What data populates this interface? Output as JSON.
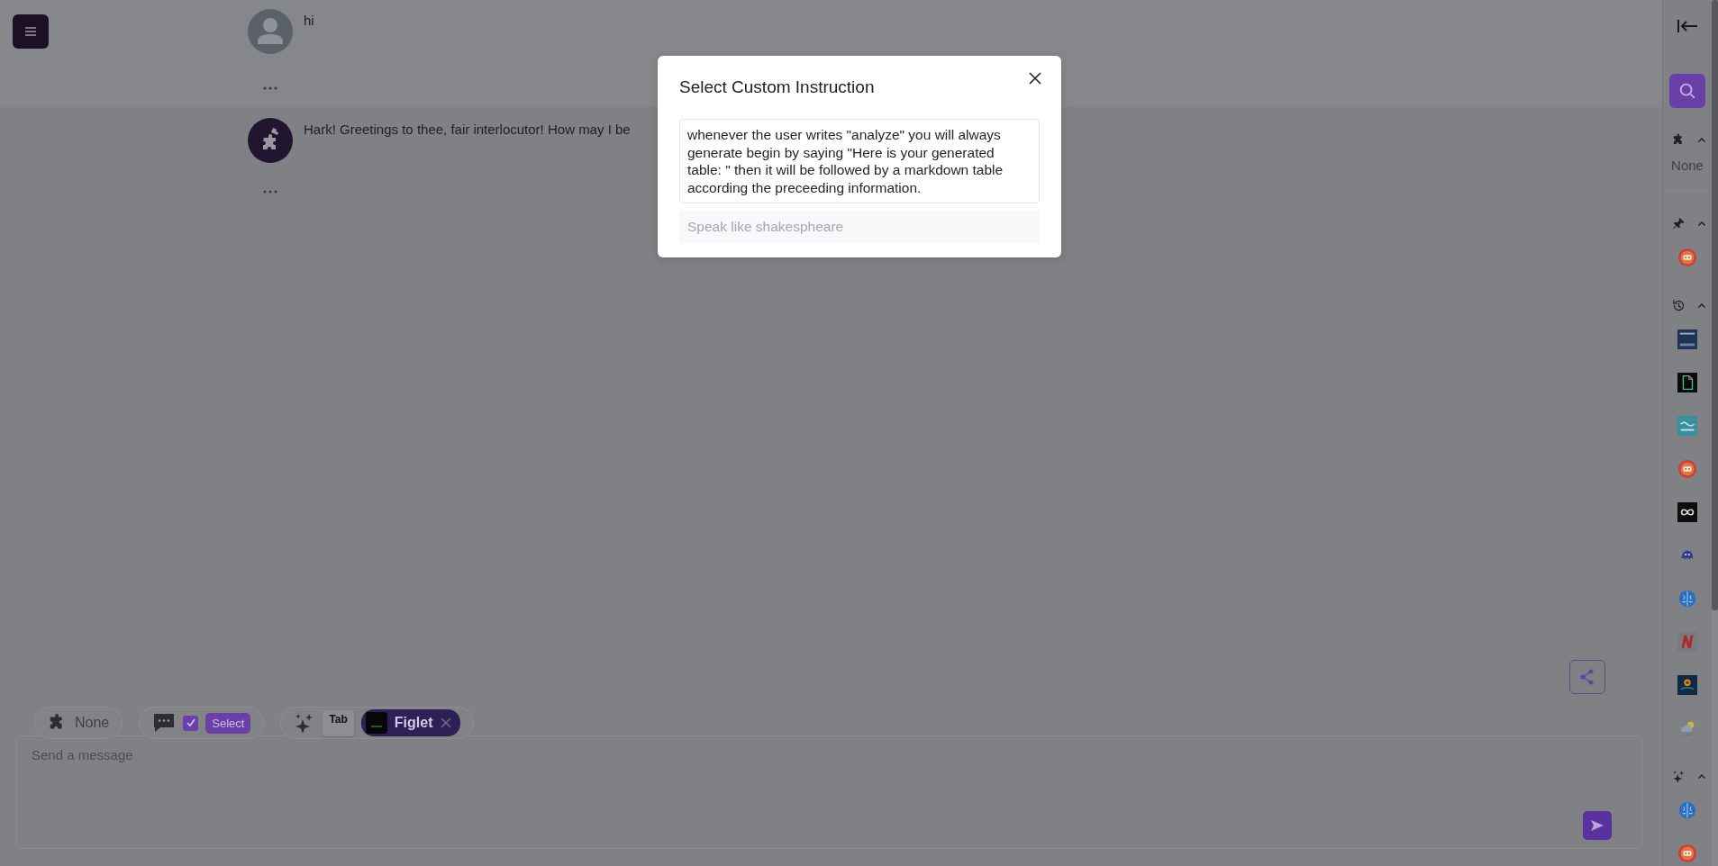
{
  "messages": [
    {
      "kind": "user",
      "text": "hi"
    },
    {
      "kind": "assistant",
      "text": "Hark! Greetings to thee, fair interlocutor! How may I be"
    }
  ],
  "composer": {
    "plugin": "None",
    "chat_option": {
      "checked": true,
      "button": "Select"
    },
    "prompt": {
      "key": "Tab",
      "chip": "Figlet"
    },
    "placeholder": "Send a message"
  },
  "sidebar": {
    "sections": [
      {
        "kind": "plugins",
        "expanded": true,
        "empty_text": "None"
      },
      {
        "kind": "pinned",
        "expanded": true,
        "items": [
          {
            "kind": "bot"
          }
        ]
      },
      {
        "kind": "history",
        "expanded": true,
        "items": [
          {
            "kind": "poster"
          },
          {
            "kind": "file"
          },
          {
            "kind": "wave"
          },
          {
            "kind": "bot"
          },
          {
            "kind": "infinity"
          },
          {
            "kind": "creature"
          },
          {
            "kind": "brain"
          },
          {
            "kind": "letter"
          },
          {
            "kind": "sunflower"
          },
          {
            "kind": "weather"
          }
        ]
      },
      {
        "kind": "prompts",
        "expanded": true,
        "items": [
          {
            "kind": "brain"
          },
          {
            "kind": "bot"
          }
        ]
      }
    ]
  },
  "modal": {
    "title": "Select Custom Instruction",
    "instructions": [
      {
        "text": "whenever the user writes \"analyze\" you will always generate begin by saying \"Here is your generated table: \" then it will be followed by a markdown table according the preceeding information.",
        "selected": true
      },
      {
        "text": "Speak like shakespheare",
        "selected": false
      }
    ]
  }
}
